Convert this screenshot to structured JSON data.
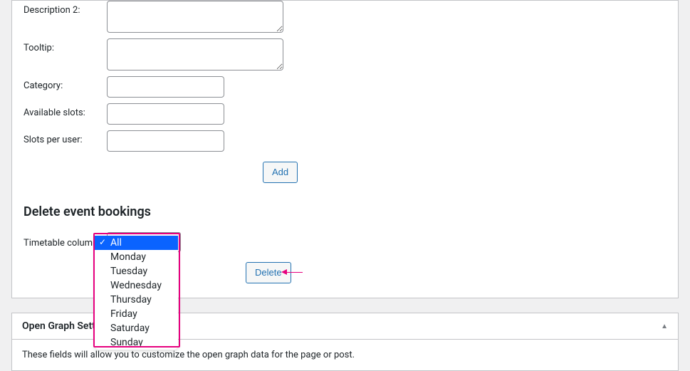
{
  "form": {
    "description2_label": "Description 2:",
    "description2_value": "",
    "tooltip_label": "Tooltip:",
    "tooltip_value": "",
    "category_label": "Category:",
    "category_value": "",
    "available_slots_label": "Available slots:",
    "available_slots_value": "",
    "slots_per_user_label": "Slots per user:",
    "slots_per_user_value": "",
    "add_button_label": "Add"
  },
  "delete_section": {
    "title": "Delete event bookings",
    "timetable_column_label": "Timetable column:",
    "delete_button_label": "Delete",
    "dropdown_options": [
      {
        "label": "All",
        "selected": true
      },
      {
        "label": "Monday",
        "selected": false
      },
      {
        "label": "Tuesday",
        "selected": false
      },
      {
        "label": "Wednesday",
        "selected": false
      },
      {
        "label": "Thursday",
        "selected": false
      },
      {
        "label": "Friday",
        "selected": false
      },
      {
        "label": "Saturday",
        "selected": false
      },
      {
        "label": "Sunday",
        "selected": false
      }
    ]
  },
  "open_graph": {
    "title": "Open Graph Settings",
    "body_text": "These fields will allow you to customize the open graph data for the page or post."
  }
}
